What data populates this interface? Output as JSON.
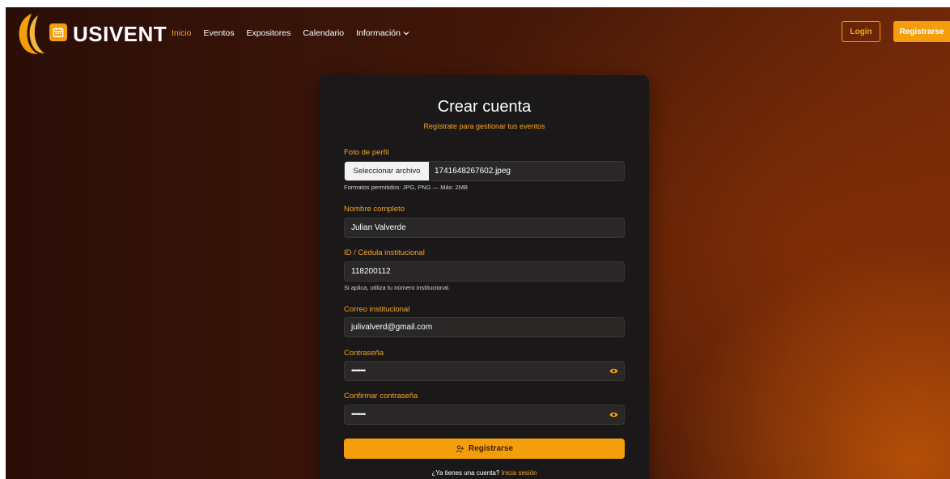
{
  "brand": {
    "name": "USIVENT",
    "logo_icon": "calendar-icon"
  },
  "nav": [
    {
      "label": "Inicio",
      "active": true
    },
    {
      "label": "Eventos"
    },
    {
      "label": "Expositores"
    },
    {
      "label": "Calendario"
    },
    {
      "label": "Información",
      "has_dropdown": true
    }
  ],
  "header_actions": {
    "login_label": "Login",
    "register_label": "Registrarse"
  },
  "form": {
    "title": "Crear cuenta",
    "subtitle": "Regístrate para gestionar tus eventos",
    "photo": {
      "label": "Foto de perfil",
      "button_label": "Seleccionar archivo",
      "file_name": "1741648267602.jpeg",
      "hint": "Formatos permitidos: JPG, PNG — Máx: 2MB"
    },
    "full_name": {
      "label": "Nombre completo",
      "value": "Julian Valverde"
    },
    "id": {
      "label": "ID / Cédula institucional",
      "value": "118200112",
      "hint": "Si aplica, utiliza tu número institucional."
    },
    "email": {
      "label": "Correo institucional",
      "value": "julivalverd@gmail.com"
    },
    "password": {
      "label": "Contraseña",
      "value": "••••••••"
    },
    "confirm_password": {
      "label": "Confirmar contraseña",
      "value": "••••••••"
    },
    "submit_label": "Registrarse",
    "login_prompt": "¿Ya tienes una cuenta?",
    "login_link": "Inicia sesión"
  },
  "colors": {
    "accent": "#f59e0b",
    "card_bg": "#1a1818",
    "field_bg": "#2a2727"
  }
}
